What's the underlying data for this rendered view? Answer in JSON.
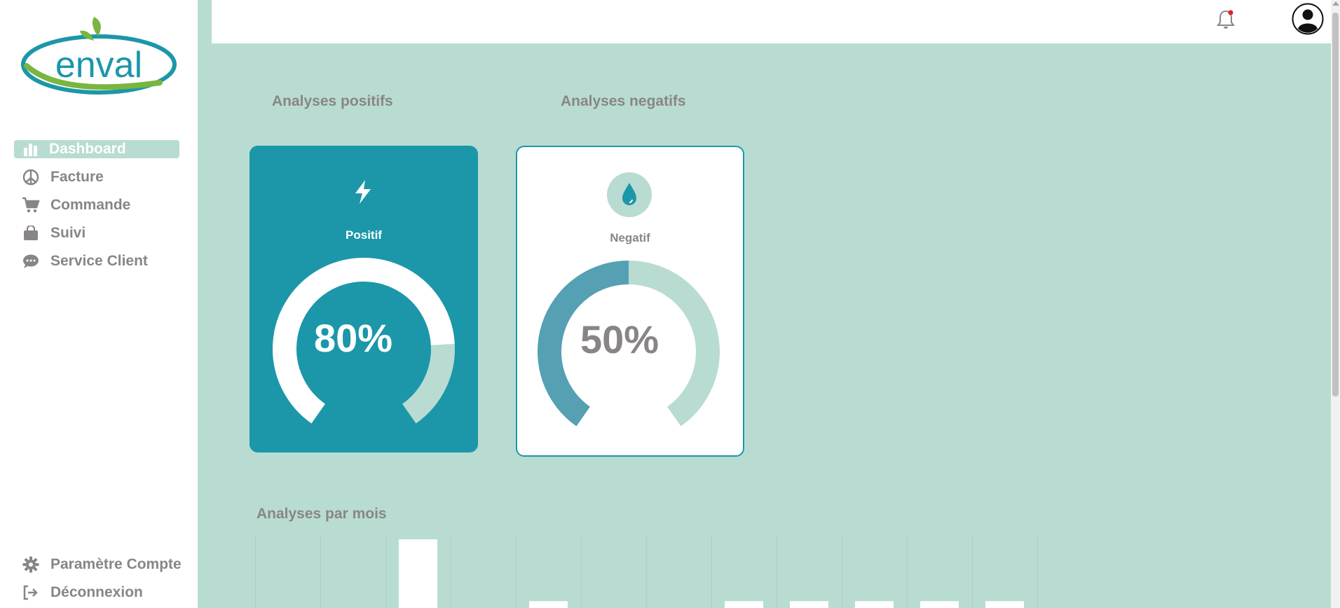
{
  "brand": {
    "logo_text": "enval"
  },
  "sidebar": {
    "items": [
      {
        "label": "Dashboard",
        "icon": "bar-chart-icon",
        "active": true
      },
      {
        "label": "Facture",
        "icon": "peace-icon"
      },
      {
        "label": "Commande",
        "icon": "cart-icon"
      },
      {
        "label": "Suivi",
        "icon": "bag-icon"
      },
      {
        "label": "Service Client",
        "icon": "chat-icon"
      }
    ],
    "bottom": [
      {
        "label": "Paramètre Compte",
        "icon": "gear-icon"
      },
      {
        "label": "Déconnexion",
        "icon": "logout-icon"
      }
    ]
  },
  "topbar": {
    "icons": [
      "bell-icon",
      "user-avatar-icon"
    ]
  },
  "main": {
    "positive_title": "Analyses positifs",
    "negative_title": "Analyses negatifs",
    "positive_card": {
      "label": "Positif",
      "value_text": "80%",
      "value": 80,
      "icon": "bolt-icon"
    },
    "negative_card": {
      "label": "Negatif",
      "value_text": "50%",
      "value": 50,
      "icon": "drop-icon"
    },
    "monthly_title": "Analyses par mois"
  },
  "colors": {
    "accent": "#1b97a9",
    "mint": "#b8dcd1",
    "gauge_dark": "#55a0b3",
    "text_gray": "#8a8585"
  },
  "chart_data": {
    "type": "bar",
    "categories": [
      "",
      "",
      "",
      "",
      "",
      "",
      "",
      "",
      "",
      "",
      "",
      ""
    ],
    "values": [
      0,
      0,
      10,
      0,
      1,
      0,
      0,
      1,
      1,
      1,
      1,
      1
    ]
  }
}
